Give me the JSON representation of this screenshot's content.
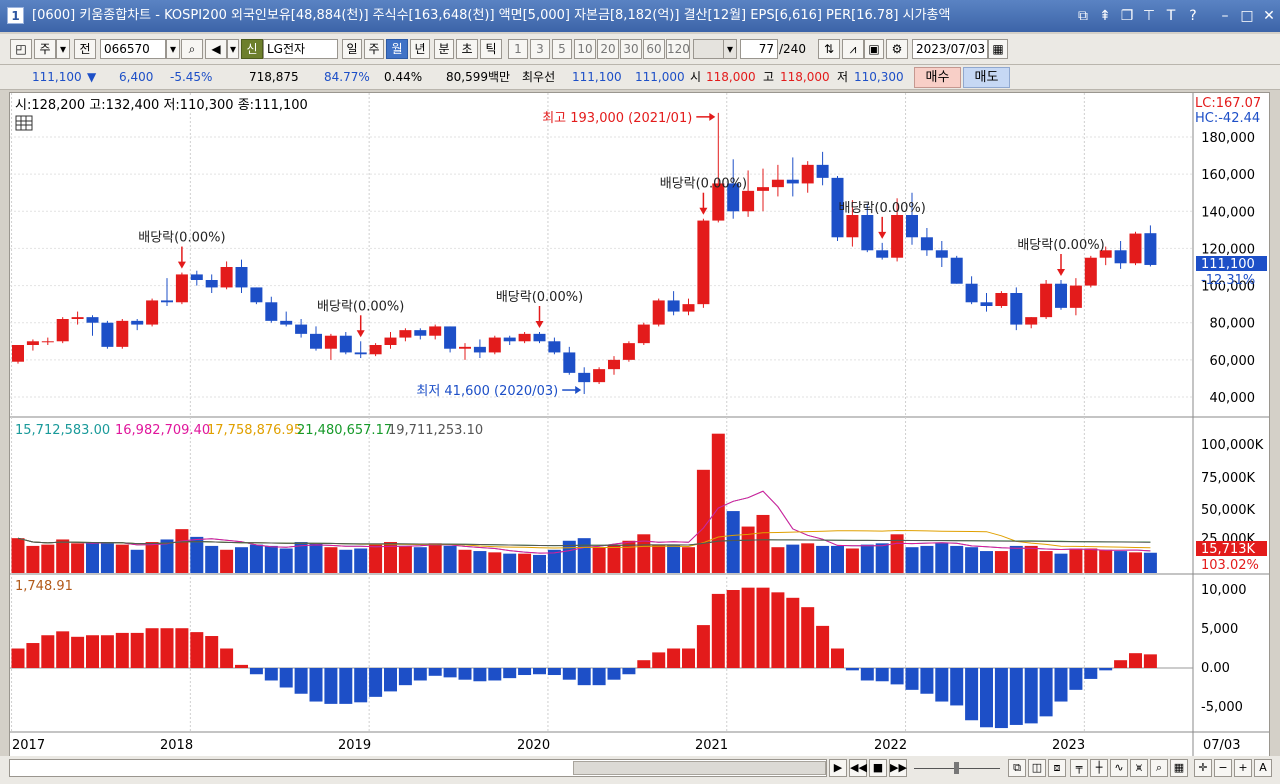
{
  "window": {
    "icon_label": "1",
    "title": "[0600] 키움종합차트 - KOSPI200 외국인보유[48,884(천)] 주식수[163,648(천)] 액면[5,000] 자본금[8,182(억)] 결산[12월] EPS[6,616] PER[16.78] 시가총액"
  },
  "toolbar": {
    "period_type": "주",
    "full_label": "전",
    "stock_code": "066570",
    "credit_badge": "신",
    "stock_name": "LG전자",
    "periods": [
      "일",
      "주",
      "월",
      "년",
      "분",
      "초",
      "틱"
    ],
    "selected_period": "월",
    "intervals": [
      "1",
      "3",
      "5",
      "10",
      "20",
      "30",
      "60",
      "120"
    ],
    "count_value": "77",
    "count_total": "/240",
    "date": "2023/07/03"
  },
  "quote": {
    "price": "111,100",
    "arrow": "▼",
    "change": "6,400",
    "change_pct": "-5.45%",
    "volume": "718,875",
    "vol_ratio": "84.77%",
    "turnover": "0.44%",
    "amount": "80,599백만",
    "best_label": "최우선",
    "best_ask": "111,100",
    "best_bid": "111,000",
    "open_label": "시",
    "open": "118,000",
    "high_label": "고",
    "high": "118,000",
    "low_label": "저",
    "low": "110,300",
    "buy_label": "매수",
    "sell_label": "매도"
  },
  "price_panel": {
    "ohlc_label": "시:128,200 고:132,400 저:110,300 종:111,100",
    "lc_label": "LC:167.07",
    "hc_label": "HC:-42.44",
    "y_ticks": [
      180000,
      160000,
      140000,
      120000,
      100000,
      80000,
      60000,
      40000
    ],
    "current_price_label": "111,100",
    "current_pct_label": "-12.31%",
    "annotations": {
      "high": "최고 193,000 (2021/01)",
      "low": "최저 41,600 (2020/03)",
      "dividend": "배당락(0.00%)"
    }
  },
  "volume_panel": {
    "ma_labels": [
      "15,712,583.00",
      "16,982,709.40",
      "17,758,876.95",
      "21,480,657.17",
      "19,711,253.10"
    ],
    "ma_colors": [
      "#1a9a9a",
      "#e0169c",
      "#e0a000",
      "#179a2a",
      "#555555"
    ],
    "y_ticks": [
      "100,000K",
      "75,000K",
      "50,000K",
      "25,000K"
    ],
    "current_volume_label": "15,713K",
    "current_pct_label": "103.02%"
  },
  "oscillator_panel": {
    "value_label": "1,748.91",
    "y_ticks": [
      "10,000",
      "5,000",
      "0.00",
      "-5,000"
    ]
  },
  "x_axis": {
    "labels": [
      "2017",
      "2018",
      "2019",
      "2020",
      "2021",
      "2022",
      "2023",
      "07/03"
    ]
  },
  "chart_data": {
    "type": "candlestick",
    "start": "2017/01",
    "interval": "month",
    "ohlc": [
      [
        59000,
        68000,
        58000,
        68000
      ],
      [
        68000,
        71000,
        65000,
        70000
      ],
      [
        70000,
        72000,
        68000,
        70000
      ],
      [
        70000,
        83000,
        69000,
        82000
      ],
      [
        82000,
        86000,
        79000,
        83000
      ],
      [
        83000,
        84000,
        73000,
        80000
      ],
      [
        80000,
        81000,
        66000,
        67000
      ],
      [
        67000,
        82000,
        66000,
        81000
      ],
      [
        81000,
        82000,
        76000,
        79000
      ],
      [
        79000,
        93000,
        78000,
        92000
      ],
      [
        92000,
        104000,
        89000,
        91000
      ],
      [
        91000,
        107000,
        90000,
        106000
      ],
      [
        106000,
        108000,
        100000,
        103000
      ],
      [
        103000,
        106000,
        96000,
        99000
      ],
      [
        99000,
        113000,
        98000,
        110000
      ],
      [
        110000,
        114000,
        96000,
        99000
      ],
      [
        99000,
        99000,
        90000,
        91000
      ],
      [
        91000,
        94000,
        80000,
        81000
      ],
      [
        81000,
        86000,
        78000,
        79000
      ],
      [
        79000,
        82000,
        72000,
        74000
      ],
      [
        74000,
        78000,
        65000,
        66000
      ],
      [
        66000,
        74000,
        60000,
        73000
      ],
      [
        73000,
        75000,
        63000,
        64000
      ],
      [
        64000,
        70000,
        61000,
        63000
      ],
      [
        63000,
        69000,
        62000,
        68000
      ],
      [
        68000,
        75000,
        66000,
        72000
      ],
      [
        72000,
        77000,
        70000,
        76000
      ],
      [
        76000,
        77000,
        71000,
        73000
      ],
      [
        73000,
        79000,
        71000,
        78000
      ],
      [
        78000,
        78000,
        64000,
        66000
      ],
      [
        66000,
        69000,
        60000,
        67000
      ],
      [
        67000,
        71000,
        61000,
        64000
      ],
      [
        64000,
        73000,
        63000,
        72000
      ],
      [
        72000,
        73000,
        68000,
        70000
      ],
      [
        70000,
        75000,
        69000,
        74000
      ],
      [
        74000,
        75000,
        69000,
        70000
      ],
      [
        70000,
        72000,
        63000,
        64000
      ],
      [
        64000,
        67000,
        52000,
        53000
      ],
      [
        53000,
        56000,
        41600,
        48000
      ],
      [
        48000,
        56000,
        47000,
        55000
      ],
      [
        55000,
        62000,
        52000,
        60000
      ],
      [
        60000,
        70000,
        59000,
        69000
      ],
      [
        69000,
        80000,
        68000,
        79000
      ],
      [
        79000,
        93000,
        78000,
        92000
      ],
      [
        92000,
        97000,
        84000,
        86000
      ],
      [
        86000,
        93000,
        84000,
        90000
      ],
      [
        90000,
        136000,
        88000,
        135000
      ],
      [
        135000,
        193000,
        134000,
        155000
      ],
      [
        155000,
        168000,
        136000,
        140000
      ],
      [
        140000,
        162000,
        137000,
        151000
      ],
      [
        151000,
        163000,
        140000,
        153000
      ],
      [
        153000,
        165000,
        148000,
        157000
      ],
      [
        157000,
        169000,
        148000,
        155000
      ],
      [
        155000,
        167000,
        150000,
        165000
      ],
      [
        165000,
        172000,
        154000,
        158000
      ],
      [
        158000,
        159000,
        124000,
        126000
      ],
      [
        126000,
        146000,
        121000,
        138000
      ],
      [
        138000,
        144000,
        118000,
        119000
      ],
      [
        119000,
        123000,
        114000,
        115000
      ],
      [
        115000,
        147000,
        113000,
        138000
      ],
      [
        138000,
        150000,
        122000,
        126000
      ],
      [
        126000,
        131000,
        116000,
        119000
      ],
      [
        119000,
        124000,
        110000,
        115000
      ],
      [
        115000,
        116000,
        101000,
        101000
      ],
      [
        101000,
        105000,
        90000,
        91000
      ],
      [
        91000,
        96000,
        86000,
        89000
      ],
      [
        89000,
        97000,
        88000,
        96000
      ],
      [
        96000,
        99000,
        76000,
        79000
      ],
      [
        79000,
        83000,
        77000,
        83000
      ],
      [
        83000,
        103000,
        82000,
        101000
      ],
      [
        101000,
        103000,
        87000,
        88000
      ],
      [
        88000,
        104000,
        84000,
        100000
      ],
      [
        100000,
        116000,
        99000,
        115000
      ],
      [
        115000,
        121000,
        111000,
        119000
      ],
      [
        119000,
        124000,
        109000,
        112000
      ],
      [
        112000,
        129000,
        111000,
        128000
      ],
      [
        128200,
        132400,
        110300,
        111100
      ]
    ],
    "volume_millions": [
      27,
      21,
      22,
      26,
      23,
      23,
      23,
      22,
      18,
      24,
      26,
      34,
      28,
      21,
      18,
      20,
      22,
      21,
      19,
      24,
      23,
      20,
      18,
      19,
      22,
      24,
      21,
      20,
      23,
      21,
      18,
      17,
      16,
      15,
      15,
      14,
      18,
      25,
      27,
      20,
      22,
      25,
      30,
      22,
      22,
      20,
      80,
      108,
      48,
      36,
      45,
      20,
      22,
      23,
      21,
      21,
      19,
      22,
      23,
      30,
      20,
      21,
      23,
      21,
      20,
      17,
      17,
      21,
      21,
      17,
      15,
      19,
      19,
      18,
      17,
      16,
      15.7
    ],
    "oscillator": [
      2500,
      3200,
      4200,
      4700,
      4000,
      4200,
      4200,
      4500,
      4500,
      5100,
      5100,
      5100,
      4600,
      4100,
      2500,
      400,
      -800,
      -1600,
      -2500,
      -3300,
      -4300,
      -4600,
      -4600,
      -4400,
      -3700,
      -3000,
      -2200,
      -1600,
      -1000,
      -1200,
      -1500,
      -1700,
      -1600,
      -1300,
      -900,
      -800,
      -900,
      -1500,
      -2200,
      -2200,
      -1500,
      -800,
      1000,
      2000,
      2500,
      2500,
      5500,
      9500,
      10000,
      10300,
      10300,
      9700,
      9000,
      7800,
      5400,
      2500,
      -300,
      -1600,
      -1700,
      -2100,
      -2800,
      -3300,
      -4300,
      -4800,
      -6700,
      -7600,
      -7700,
      -7300,
      -7100,
      -6200,
      -4300,
      -2800,
      -1400,
      -300,
      1000,
      1900,
      1748.91
    ],
    "dividend_marks": [
      11,
      23,
      35,
      46,
      58,
      70
    ],
    "high_index": 47,
    "low_index": 38
  }
}
